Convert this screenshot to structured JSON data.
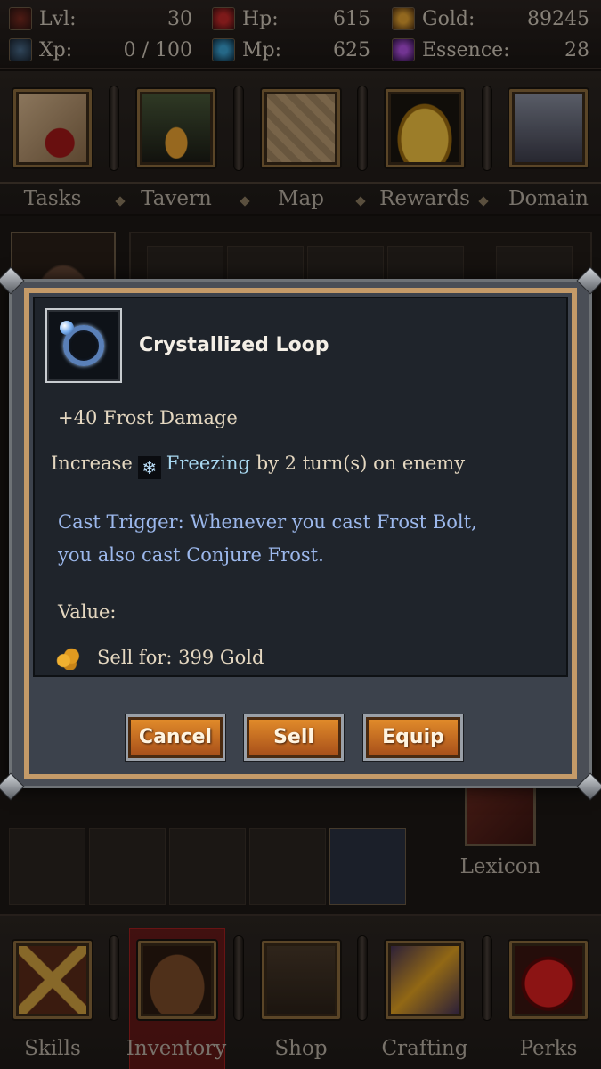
{
  "stats": {
    "lvl_label": "Lvl:",
    "lvl": "30",
    "hp_label": "Hp:",
    "hp": "615",
    "gold_label": "Gold:",
    "gold": "89245",
    "xp_label": "Xp:",
    "xp": "0 / 100",
    "mp_label": "Mp:",
    "mp": "625",
    "essence_label": "Essence:",
    "essence": "28"
  },
  "top_nav": [
    "Tasks",
    "Tavern",
    "Map",
    "Rewards",
    "Domain"
  ],
  "bottom_nav": [
    "Skills",
    "Inventory",
    "Shop",
    "Crafting",
    "Perks"
  ],
  "active_bottom_tab": "Inventory",
  "side_panel": {
    "lexicon_label": "Lexicon"
  },
  "item_modal": {
    "name": "Crystallized Loop",
    "stat_line": "+40 Frost Damage",
    "effect_prefix": "Increase",
    "effect_icon": "snowflake-icon",
    "effect_keyword": "Freezing",
    "effect_suffix": "by 2 turn(s) on enemy",
    "trigger_line1": "Cast Trigger: Whenever you cast Frost Bolt,",
    "trigger_line2": "you also cast Conjure Frost.",
    "value_label": "Value:",
    "sell_text": "Sell for: 399 Gold",
    "buttons": {
      "cancel": "Cancel",
      "sell": "Sell",
      "equip": "Equip"
    }
  },
  "colors": {
    "accent_orange": "#e08a2a",
    "frame_tan": "#c49a68",
    "trigger_blue": "#9cb8ec",
    "freezing_cyan": "#a8d8f0",
    "active_tab_red": "#a02020"
  }
}
